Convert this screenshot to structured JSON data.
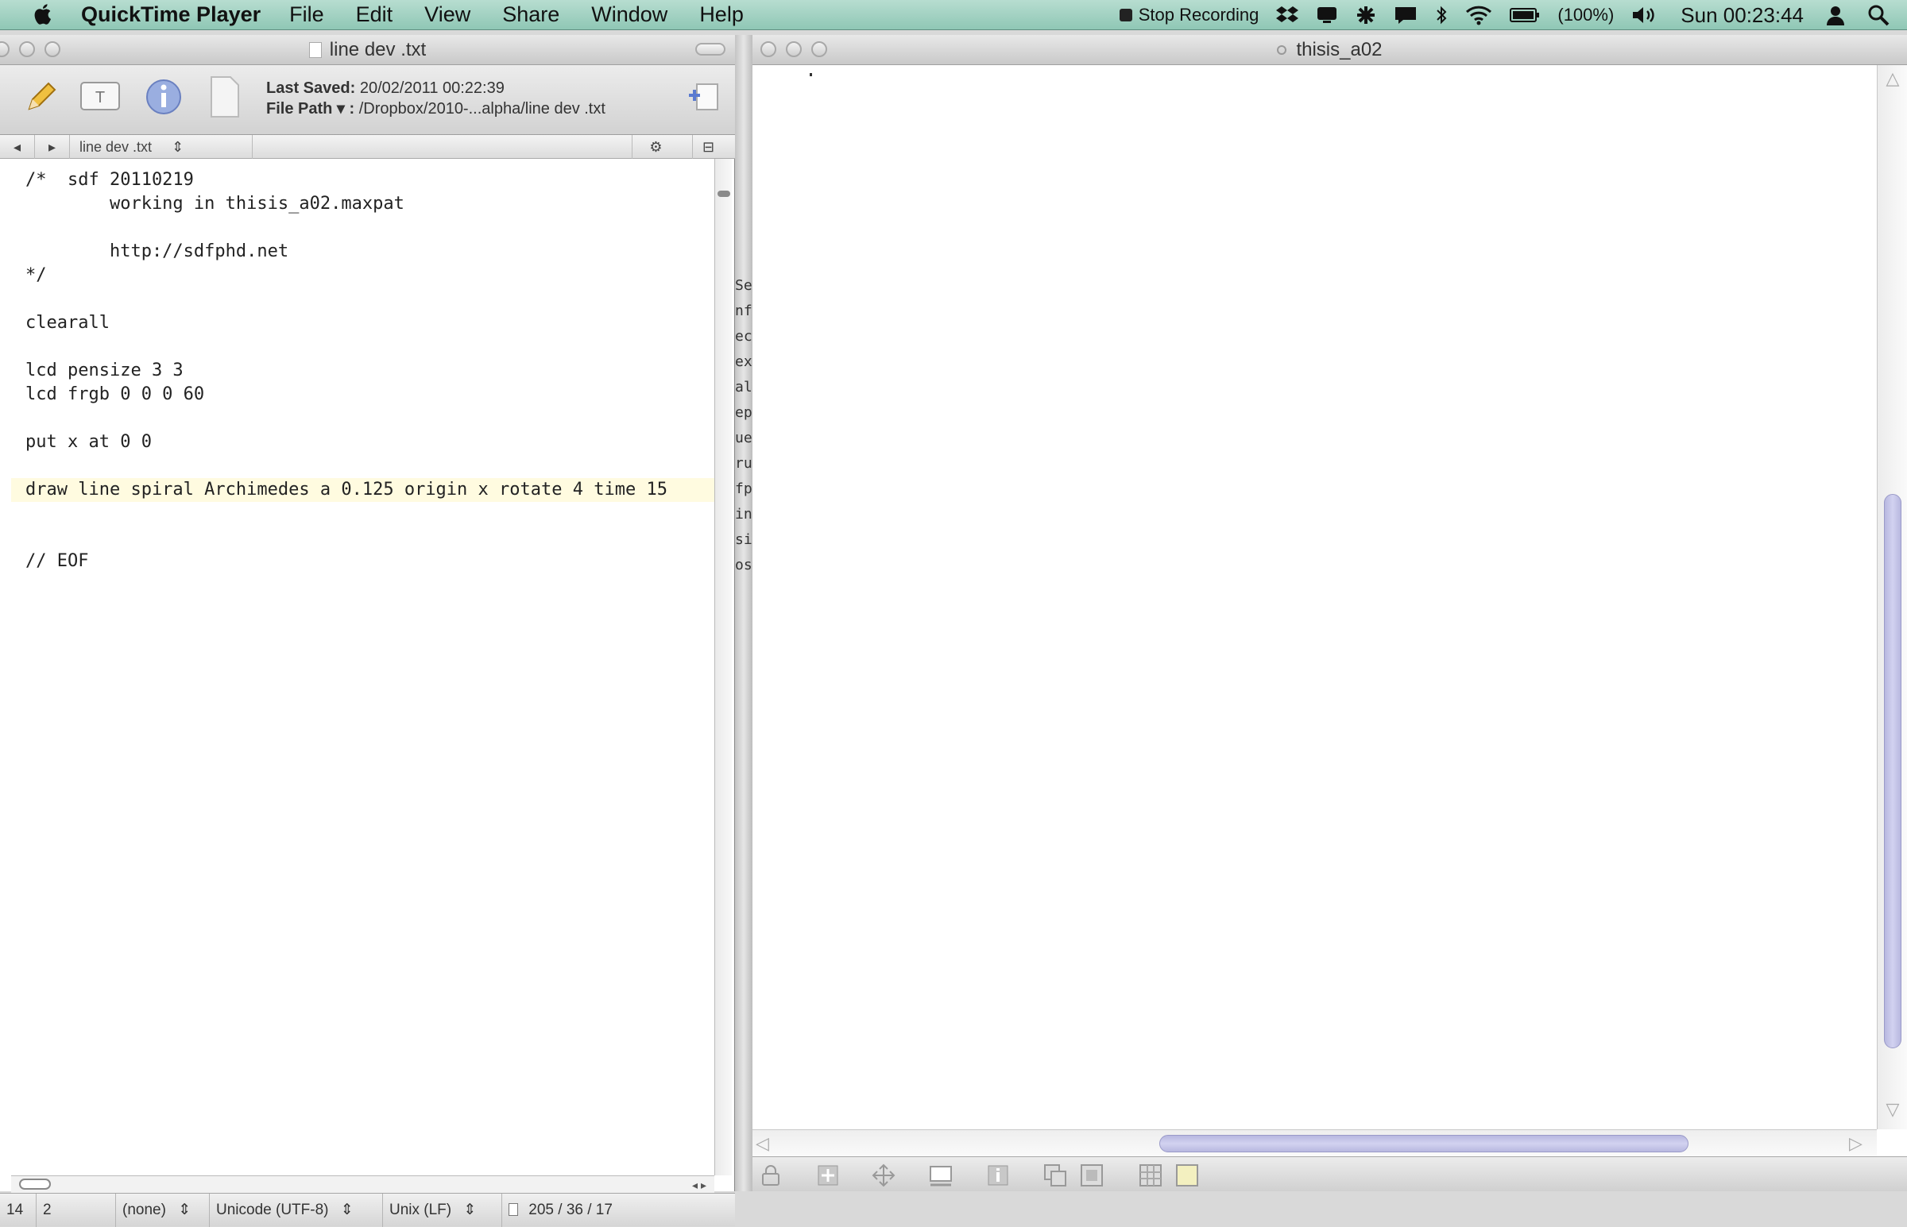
{
  "menubar": {
    "app": "QuickTime Player",
    "items": [
      "File",
      "Edit",
      "View",
      "Share",
      "Window",
      "Help"
    ],
    "status": {
      "recording": "Stop Recording",
      "battery": "(100%)",
      "clock": "Sun 00:23:44"
    }
  },
  "left_window": {
    "title": "line dev .txt",
    "toolbar": {
      "last_saved_label": "Last Saved:",
      "last_saved_value": "20/02/2011 00:22:39",
      "file_path_label": "File Path ▾ :",
      "file_path_value": "/Dropbox/2010-...alpha/line dev .txt"
    },
    "nav": {
      "back": "◂",
      "forward": "▸",
      "file_name": "line dev .txt"
    },
    "code_lines": [
      "/*  sdf 20110219",
      "        working in thisis_a02.maxpat",
      "",
      "        http://sdfphd.net",
      "*/",
      "",
      "clearall",
      "",
      "lcd pensize 3 3",
      "lcd frgb 0 0 0 60",
      "",
      "put x at 0 0",
      "",
      "draw line spiral Archimedes a 0.125 origin x rotate 4 time 15",
      "",
      "",
      "// EOF"
    ],
    "status": {
      "line": "14",
      "col": "2",
      "syntax": "(none)",
      "encoding": "Unicode (UTF-8)",
      "line_endings": "Unix (LF)",
      "counts": "205 / 36 / 17"
    }
  },
  "divider": {
    "peek_chars": [
      "Se",
      "nf",
      "ec",
      "ex",
      "al",
      "ep",
      "ue",
      "ru",
      "fp",
      "in",
      "si",
      "os"
    ]
  },
  "right_window": {
    "title": "thisis_a02"
  },
  "colors": {
    "menubar": "#a6d6c6",
    "highlight_line": "#fffbe0",
    "scroll_thumb": "#c4c4ea"
  }
}
